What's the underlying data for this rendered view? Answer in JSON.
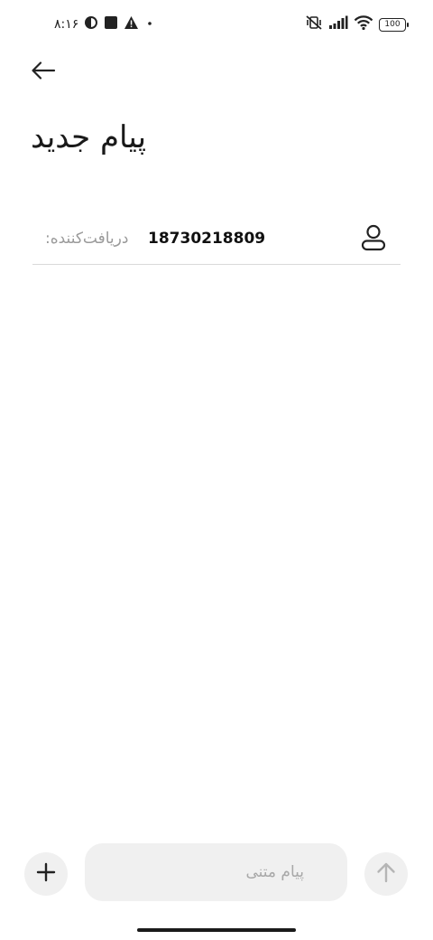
{
  "status_bar": {
    "time": "۸:۱۶",
    "battery_level": "100",
    "icons": [
      "app-notification-icon",
      "square-notification-icon",
      "warning-icon",
      "dot-icon",
      "vibrate-mute-icon",
      "signal-icon",
      "wifi-icon",
      "battery-icon"
    ]
  },
  "header": {
    "back_icon": "arrow-left-icon",
    "title": "پیام جدید"
  },
  "recipient": {
    "label": "دریافت‌کننده:",
    "value": "18730218809",
    "contact_icon": "person-icon"
  },
  "composer": {
    "placeholder": "پیام متنی",
    "attach_icon": "plus-icon",
    "send_icon": "arrow-up-icon"
  },
  "colors": {
    "background": "#ffffff",
    "field_bg": "#f0f0f0",
    "placeholder": "#a8a8a8",
    "text": "#111111"
  }
}
